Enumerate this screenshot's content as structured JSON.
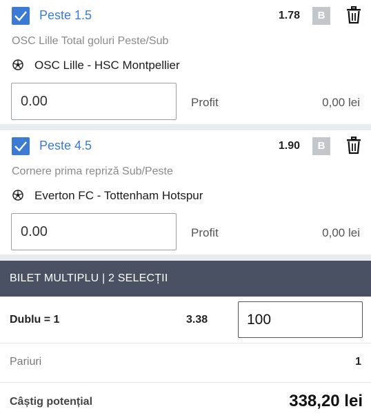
{
  "bets": [
    {
      "selection": "Peste 1.5",
      "odd": "1.78",
      "badge": "B",
      "market": "OSC Lille Total goluri Peste/Sub",
      "match": "OSC Lille - HSC Montpellier",
      "stake": "0.00",
      "profit_label": "Profit",
      "profit_value": "0,00 lei",
      "checked": true
    },
    {
      "selection": "Peste 4.5",
      "odd": "1.90",
      "badge": "B",
      "market": "Cornere prima repriză Sub/Peste",
      "match": "Everton FC - Tottenham Hotspur",
      "stake": "0.00",
      "profit_label": "Profit",
      "profit_value": "0,00 lei",
      "checked": true
    }
  ],
  "multi": {
    "title": "BILET MULTIPLU | 2 SELECȚII",
    "combo_label": "Dublu = 1",
    "combo_odd": "3.38",
    "combo_stake": "100",
    "bets_label": "Pariuri",
    "bets_count": "1",
    "win_label": "Câștig potențial",
    "win_value": "338,20 lei"
  },
  "colors": {
    "accent": "#3b7bd4",
    "header_bg": "#4a5163",
    "badge_bg": "#c3c7cc",
    "page_bg": "#e9ecef"
  },
  "icons": [
    "checkbox-checked-icon",
    "trash-icon",
    "soccer-ball-icon"
  ]
}
